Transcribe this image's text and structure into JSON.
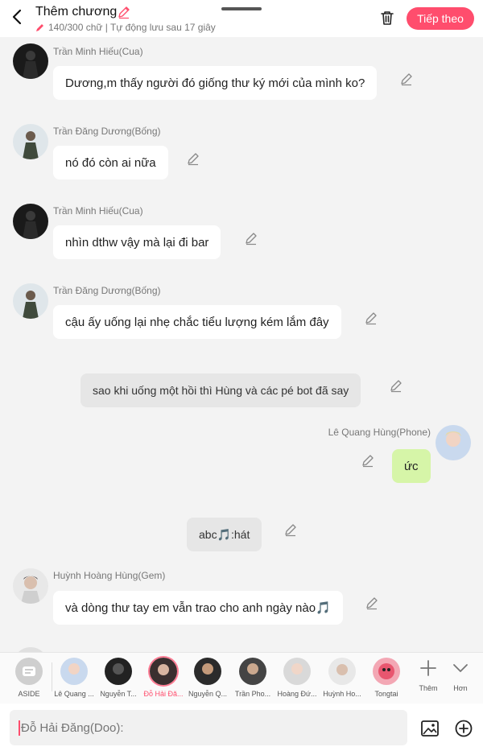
{
  "header": {
    "title": "Thêm chương",
    "subtitle": "140/300 chữ | Tự động lưu sau 17 giây",
    "next_label": "Tiếp theo"
  },
  "messages": [
    {
      "speaker": "Trần Minh Hiếu(Cua)",
      "text": "Dương,m thấy người đó giống thư ký mới của mình ko?"
    },
    {
      "speaker": "Trần Đăng Dương(Bống)",
      "text": "nó đó còn ai nữa"
    },
    {
      "speaker": "Trần Minh Hiếu(Cua)",
      "text": "nhìn dthw vậy mà lại đi bar"
    },
    {
      "speaker": "Trần Đăng Dương(Bống)",
      "text": "cậu ấy uống lại nhẹ chắc tiểu lượng kém lắm đây"
    },
    {
      "speaker": "",
      "text": "sao khi uống một hồi thì Hùng và các pé bot đã say"
    },
    {
      "speaker": "Lê Quang Hùng(Phone)",
      "text": "ức"
    },
    {
      "speaker": "",
      "text": "abc🎵:hát"
    },
    {
      "speaker": "Huỳnh Hoàng Hùng(Gem)",
      "text": "và dòng thư tay em vẫn trao cho anh ngày nào🎵"
    }
  ],
  "characters": [
    {
      "label": "ASIDE"
    },
    {
      "label": "Lê Quang ..."
    },
    {
      "label": "Nguyễn T..."
    },
    {
      "label": "Đỗ Hải Đă..."
    },
    {
      "label": "Nguyễn Q..."
    },
    {
      "label": "Trần Pho..."
    },
    {
      "label": "Hoàng Đứ..."
    },
    {
      "label": "Huỳnh Ho..."
    },
    {
      "label": "Tongtai"
    }
  ],
  "tools": {
    "more_label": "Thêm",
    "less_label": "Hơn"
  },
  "input": {
    "placeholder": "Đỗ Hải Đăng(Doo):"
  },
  "colors": {
    "accent": "#ff4d6d",
    "background": "#f3f3f3",
    "bubble": "#ffffff",
    "aside_bubble": "#e6e6e6",
    "self_bubble": "#d6f5a8"
  }
}
